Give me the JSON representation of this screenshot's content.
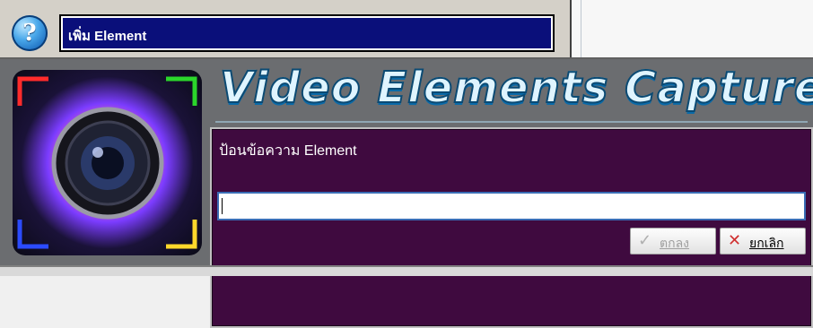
{
  "top": {
    "help_icon": "question-mark-icon",
    "title": "เพิ่ม Element"
  },
  "app": {
    "title": "Video Elements Capture",
    "logo": "camera-lens-logo"
  },
  "panel": {
    "prompt": "ป้อนข้อความ Element",
    "input_value": "",
    "ok_label": "ตกลง",
    "ok_icon": "checkmark-icon",
    "cancel_label": "ยกเลิก",
    "cancel_icon": "cross-icon"
  },
  "colors": {
    "title_field_bg": "#0a0f7a",
    "panel_bg": "#3f0a3f",
    "app_title_color": "#dff4ff"
  }
}
